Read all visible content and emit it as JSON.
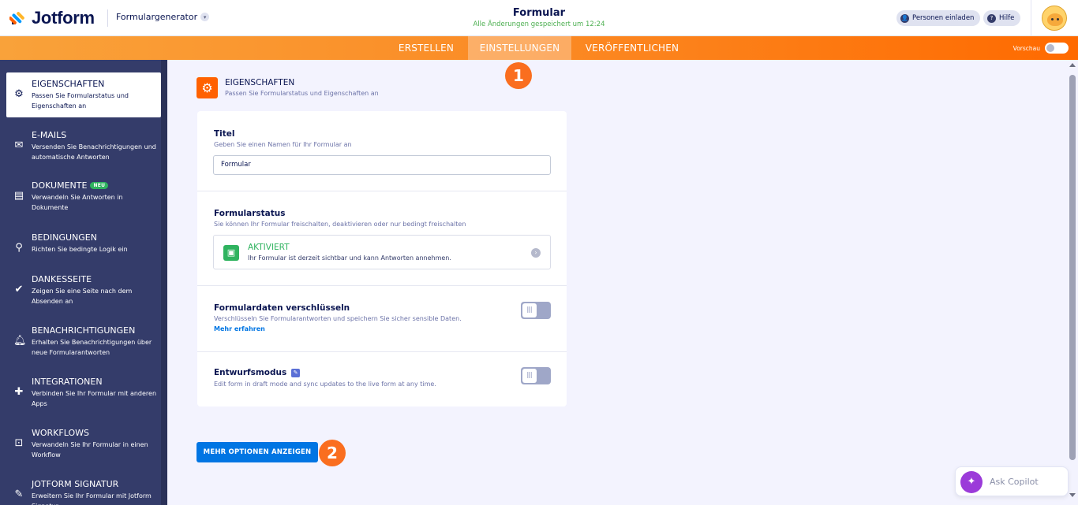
{
  "header": {
    "logo_text": "Jotform",
    "product": "Formulargenerator",
    "form_title": "Formular",
    "saved_status": "Alle Änderungen gespeichert um 12:24",
    "invite_label": "Personen einladen",
    "help_label": "Hilfe"
  },
  "tabs": [
    {
      "label": "ERSTELLEN"
    },
    {
      "label": "EINSTELLUNGEN"
    },
    {
      "label": "VERÖFFENTLICHEN"
    }
  ],
  "preview_label": "Vorschau",
  "sidebar": {
    "items": [
      {
        "title": "EIGENSCHAFTEN",
        "desc": "Passen Sie Formularstatus und Eigenschaften an",
        "icon": "gear-icon"
      },
      {
        "title": "E-MAILS",
        "desc": "Versenden Sie Benachrichtigungen und automatische Antworten",
        "icon": "envelope-icon"
      },
      {
        "title": "DOKUMENTE",
        "badge": "NEU",
        "desc": "Verwandeln Sie Antworten in Dokumente",
        "icon": "document-icon"
      },
      {
        "title": "BEDINGUNGEN",
        "desc": "Richten Sie bedingte Logik ein",
        "icon": "logic-tree-icon"
      },
      {
        "title": "DANKESSEITE",
        "desc": "Zeigen Sie eine Seite nach dem Absenden an",
        "icon": "check-circle-icon"
      },
      {
        "title": "BENACHRICHTIGUNGEN",
        "desc": "Erhalten Sie Benachrichtigungen über neue Formularantworten",
        "icon": "bell-icon"
      },
      {
        "title": "INTEGRATIONEN",
        "desc": "Verbinden Sie Ihr Formular mit anderen Apps",
        "icon": "puzzle-icon"
      },
      {
        "title": "WORKFLOWS",
        "desc": "Verwandeln Sie Ihr Formular in einen Workflow",
        "icon": "workflow-icon"
      },
      {
        "title": "JOTFORM SIGNATUR",
        "desc": "Erweitern Sie Ihr Formular mit Jotform Signatur",
        "icon": "pen-icon"
      }
    ]
  },
  "section": {
    "title": "EIGENSCHAFTEN",
    "subtitle": "Passen Sie Formularstatus und Eigenschaften an"
  },
  "settings": {
    "title_label": "Titel",
    "title_hint": "Geben Sie einen Namen für Ihr Formular an",
    "title_value": "Formular",
    "status_label": "Formularstatus",
    "status_hint": "Sie können Ihr Formular freischalten, deaktivieren oder nur bedingt freischalten",
    "status_value": "AKTIVIERT",
    "status_desc": "Ihr Formular ist derzeit sichtbar und kann Antworten annehmen.",
    "encrypt_label": "Formulardaten verschlüsseln",
    "encrypt_hint": "Verschlüsseln Sie Formularantworten und speichern Sie sicher sensible Daten.",
    "encrypt_link": "Mehr erfahren",
    "draft_label": "Entwurfsmodus",
    "draft_hint": "Edit form in draft mode and sync updates to the live form at any time."
  },
  "more_options_label": "MEHR OPTIONEN ANZEIGEN",
  "steps": [
    "1",
    "2"
  ],
  "copilot_label": "Ask Copilot"
}
